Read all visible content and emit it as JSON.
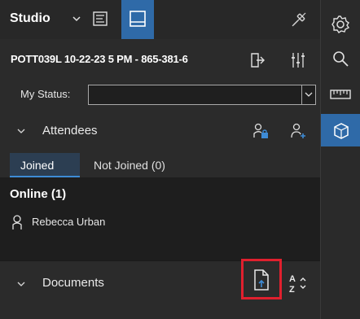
{
  "header": {
    "title": "Studio",
    "icons": [
      "chevron-down-icon",
      "notes-icon",
      "layout-icon",
      "pin-icon"
    ]
  },
  "session": {
    "text": "POTT039L 10-22-23 5 PM - 865-381-6",
    "icons": [
      "exit-icon",
      "sliders-icon"
    ]
  },
  "status": {
    "label": "My Status:",
    "value": ""
  },
  "attendees": {
    "title": "Attendees",
    "tabs": [
      {
        "label": "Joined",
        "active": true
      },
      {
        "label": "Not Joined (0)",
        "active": false
      }
    ],
    "online_header": "Online (1)",
    "people": [
      {
        "name": "Rebecca Urban"
      }
    ]
  },
  "documents": {
    "title": "Documents"
  },
  "rail": {
    "items": [
      "settings-icon",
      "search-icon",
      "ruler-icon",
      "cube-icon"
    ],
    "active_index": 3
  },
  "colors": {
    "accent": "#2f6aa8",
    "tab_underline": "#3d8bd6",
    "highlight_box": "#e0202e",
    "background": "#2b2b2b",
    "list_background": "#1e1e1e"
  }
}
